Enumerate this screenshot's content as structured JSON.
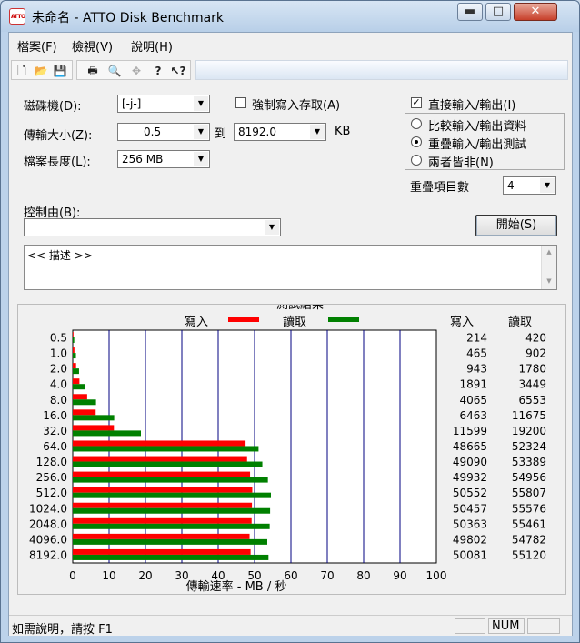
{
  "window": {
    "title": "未命名 - ATTO Disk Benchmark",
    "icon_text": "ATTO",
    "controls": {
      "minimize": "▬",
      "maximize": "□",
      "close": "✕"
    }
  },
  "menu": [
    "檔案(F)",
    "檢視(V)",
    "說明(H)"
  ],
  "toolbar_icons": [
    "new-icon",
    "open-icon",
    "save-icon",
    "print-icon",
    "print-preview-icon",
    "move-icon",
    "help-icon",
    "context-help-icon"
  ],
  "form": {
    "drive_label": "磁碟機(D):",
    "drive_value": "[-j-]",
    "force_write_label": "強制寫入存取(A)",
    "force_write_checked": false,
    "direct_io_label": "直接輸入/輸出(I)",
    "direct_io_checked": true,
    "transfer_label": "傳輸大小(Z):",
    "transfer_from": "0.5",
    "to_label": "到",
    "transfer_to": "8192.0",
    "kb_label": "KB",
    "length_label": "檔案長度(L):",
    "length_value": "256 MB",
    "radio_options": [
      "比較輸入/輸出資料",
      "重疊輸入/輸出測試",
      "兩者皆非(N)"
    ],
    "radio_selected": 1,
    "queue_label": "重疊項目數",
    "queue_value": "4",
    "controlled_by_label": "控制由(B):",
    "controlled_by_value": "",
    "start_button": "開始(S)",
    "description_text": "<< 描述 >>"
  },
  "results": {
    "title": "測試結果",
    "write_legend": "寫入",
    "read_legend": "讀取",
    "write_header": "寫入",
    "read_header": "讀取",
    "xlabel": "傳輸速率 - MB / 秒",
    "write_color": "#ff0000",
    "read_color": "#008000"
  },
  "chart_data": {
    "type": "bar",
    "orientation": "horizontal",
    "categories": [
      "0.5",
      "1.0",
      "2.0",
      "4.0",
      "8.0",
      "16.0",
      "32.0",
      "64.0",
      "128.0",
      "256.0",
      "512.0",
      "1024.0",
      "2048.0",
      "4096.0",
      "8192.0"
    ],
    "series": [
      {
        "name": "寫入",
        "values": [
          214,
          465,
          943,
          1891,
          4065,
          6463,
          11599,
          48665,
          49090,
          49932,
          50552,
          50457,
          50363,
          49802,
          50081
        ]
      },
      {
        "name": "讀取",
        "values": [
          420,
          902,
          1780,
          3449,
          6553,
          11675,
          19200,
          52324,
          53389,
          54956,
          55807,
          55576,
          55461,
          54782,
          55120
        ]
      }
    ],
    "xticks": [
      "0",
      "10",
      "20",
      "30",
      "40",
      "50",
      "60",
      "70",
      "80",
      "90",
      "100"
    ],
    "xlim": [
      0,
      100
    ],
    "xlabel": "傳輸速率 - MB / 秒"
  },
  "status": {
    "help_text": "如需說明，請按 F1",
    "num": "NUM"
  }
}
